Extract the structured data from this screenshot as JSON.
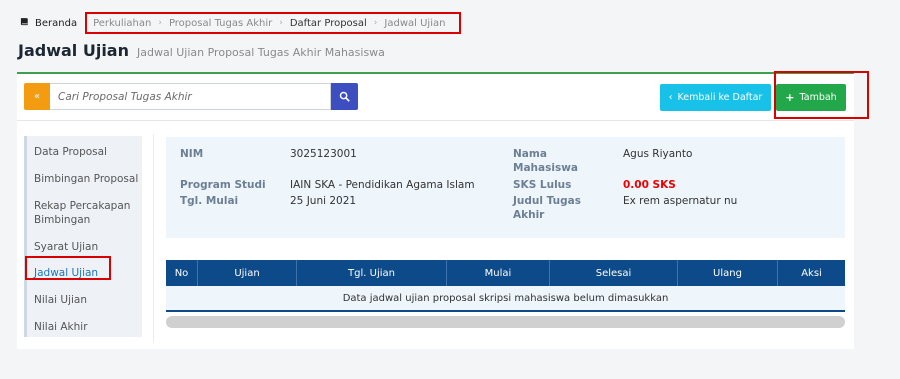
{
  "breadcrumb": {
    "home": "Beranda",
    "items": [
      "Perkuliahan",
      "Proposal Tugas Akhir",
      "Daftar Proposal",
      "Jadwal Ujian"
    ]
  },
  "page": {
    "title": "Jadwal Ujian",
    "subtitle": "Jadwal Ujian Proposal Tugas Akhir Mahasiswa"
  },
  "toolbar": {
    "collapse_icon": "double-chevron-left-icon",
    "search_placeholder": "Cari Proposal Tugas Akhir",
    "search_icon": "search-icon",
    "back_label": "Kembali ke Daftar",
    "add_label": "Tambah"
  },
  "sidebar": {
    "items": [
      {
        "label": "Data Proposal"
      },
      {
        "label": "Bimbingan Proposal"
      },
      {
        "label": "Rekap Percakapan Bimbingan"
      },
      {
        "label": "Syarat Ujian"
      },
      {
        "label": "Jadwal Ujian"
      },
      {
        "label": "Nilai Ujian"
      },
      {
        "label": "Nilai Akhir"
      }
    ],
    "active": "Jadwal Ujian"
  },
  "student": {
    "nim_label": "NIM",
    "nim": "3025123001",
    "prodi_label": "Program Studi",
    "prodi": "IAIN SKA - Pendidikan Agama Islam",
    "tgl_label": "Tgl. Mulai",
    "tgl": "25 Juni 2021",
    "nama_label_1": "Nama",
    "nama_label_2": "Mahasiswa",
    "nama": "Agus Riyanto",
    "sks_label": "SKS Lulus",
    "sks": "0.00 SKS",
    "judul_label_1": "Judul Tugas",
    "judul_label_2": "Akhir",
    "judul": "Ex rem aspernatur nu"
  },
  "table": {
    "columns": [
      "No",
      "Ujian",
      "Tgl. Ujian",
      "Mulai",
      "Selesai",
      "Ulang",
      "Aksi"
    ],
    "empty_message": "Data jadwal ujian proposal skripsi mahasiswa belum dimasukkan"
  },
  "colors": {
    "accent_green": "#22a84a",
    "header_blue": "#0d4a8a",
    "info_cyan": "#17c1e8",
    "highlight_red": "#d90000"
  }
}
